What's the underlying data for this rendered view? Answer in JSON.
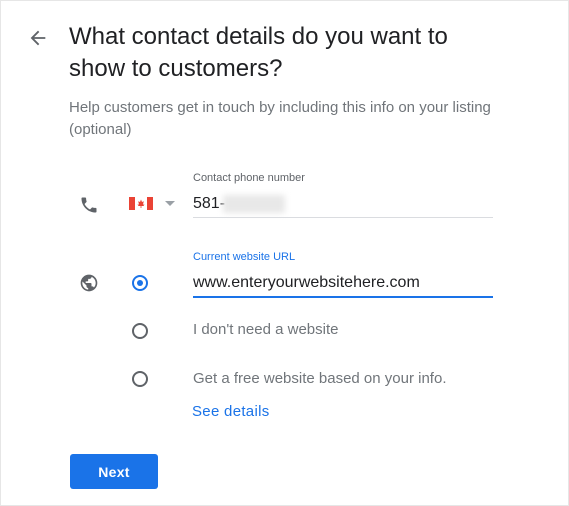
{
  "header": {
    "title": "What contact details do you want to show to customers?",
    "subtitle": "Help customers get in touch by including this info on your listing (optional)"
  },
  "phone": {
    "label": "Contact phone number",
    "country": "Canada",
    "value": "581-"
  },
  "website": {
    "label": "Current website URL",
    "value": "www.enteryourwebsitehere.com",
    "options": [
      {
        "label": "",
        "checked": true
      },
      {
        "label": "I don't need a website",
        "checked": false
      },
      {
        "label": "Get a free website based on your info.",
        "checked": false
      }
    ],
    "see_details": "See details"
  },
  "actions": {
    "next_label": "Next"
  },
  "colors": {
    "accent": "#1a73e8",
    "text": "#202124",
    "secondary": "#70757a"
  }
}
